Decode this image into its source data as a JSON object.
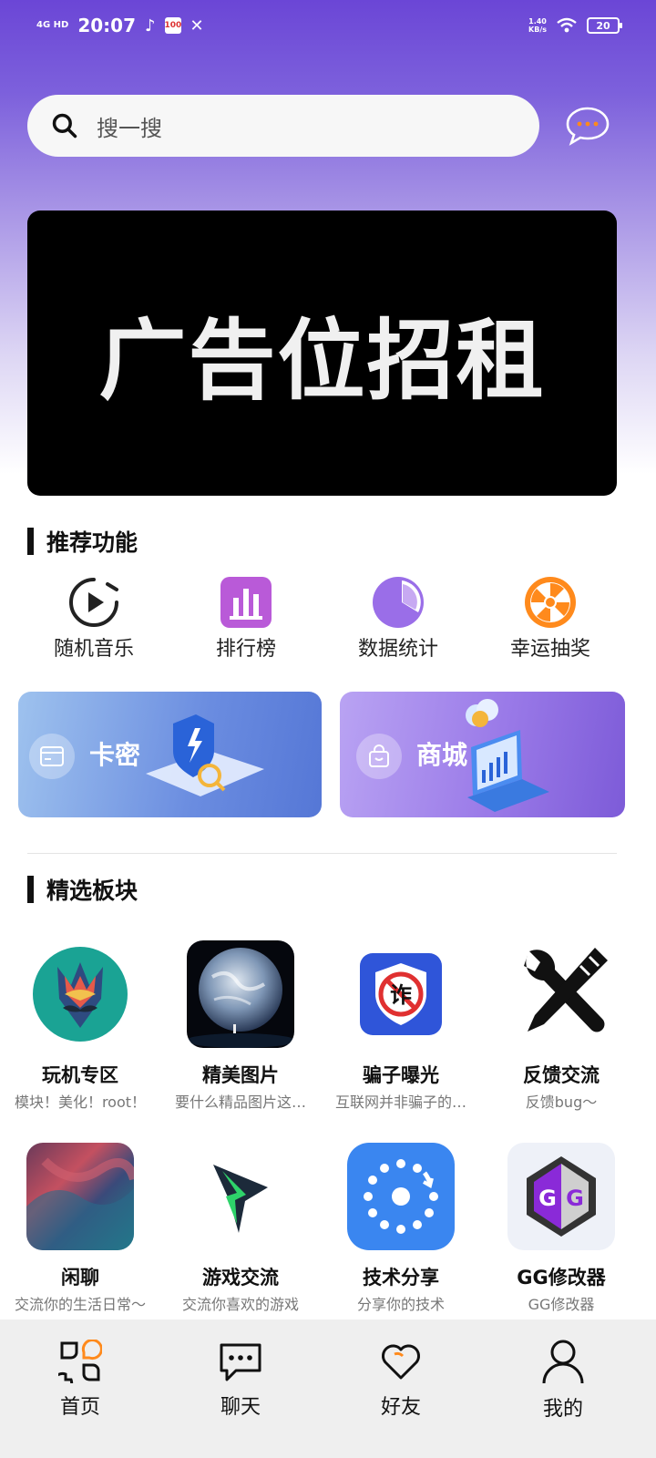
{
  "status_bar": {
    "network": "4G HD",
    "time": "20:07",
    "speed_value": "1.40",
    "speed_unit": "KB/s",
    "battery": "20"
  },
  "search": {
    "placeholder": "搜一搜"
  },
  "banner": {
    "text": "广告位招租"
  },
  "sections": {
    "recommended": "推荐功能",
    "featured": "精选板块"
  },
  "functions": [
    {
      "label": "随机音乐",
      "icon": "play-circle-icon"
    },
    {
      "label": "排行榜",
      "icon": "bar-chart-icon"
    },
    {
      "label": "数据统计",
      "icon": "pie-chart-icon"
    },
    {
      "label": "幸运抽奖",
      "icon": "lucky-wheel-icon"
    }
  ],
  "cards": [
    {
      "label": "卡密",
      "icon": "card-icon"
    },
    {
      "label": "商城",
      "icon": "shopping-bag-icon"
    }
  ],
  "boards": [
    {
      "title": "玩机专区",
      "desc": "模块！美化！root！"
    },
    {
      "title": "精美图片",
      "desc": "要什么精品图片这…"
    },
    {
      "title": "骗子曝光",
      "desc": "互联网并非骗子的…"
    },
    {
      "title": "反馈交流",
      "desc": "反馈bug～"
    },
    {
      "title": "闲聊",
      "desc": "交流你的生活日常～"
    },
    {
      "title": "游戏交流",
      "desc": "交流你喜欢的游戏"
    },
    {
      "title": "技术分享",
      "desc": "分享你的技术"
    },
    {
      "title": "GG修改器",
      "desc": "GG修改器"
    }
  ],
  "tabs": [
    {
      "label": "首页",
      "icon": "home-grid-icon"
    },
    {
      "label": "聊天",
      "icon": "chat-icon"
    },
    {
      "label": "好友",
      "icon": "heart-icon"
    },
    {
      "label": "我的",
      "icon": "person-icon"
    }
  ],
  "colors": {
    "header_purple": "#6b46d6",
    "card_blue": "#6a8ce0",
    "card_purple": "#9a7ae8",
    "accent_orange": "#ff8a1c"
  }
}
